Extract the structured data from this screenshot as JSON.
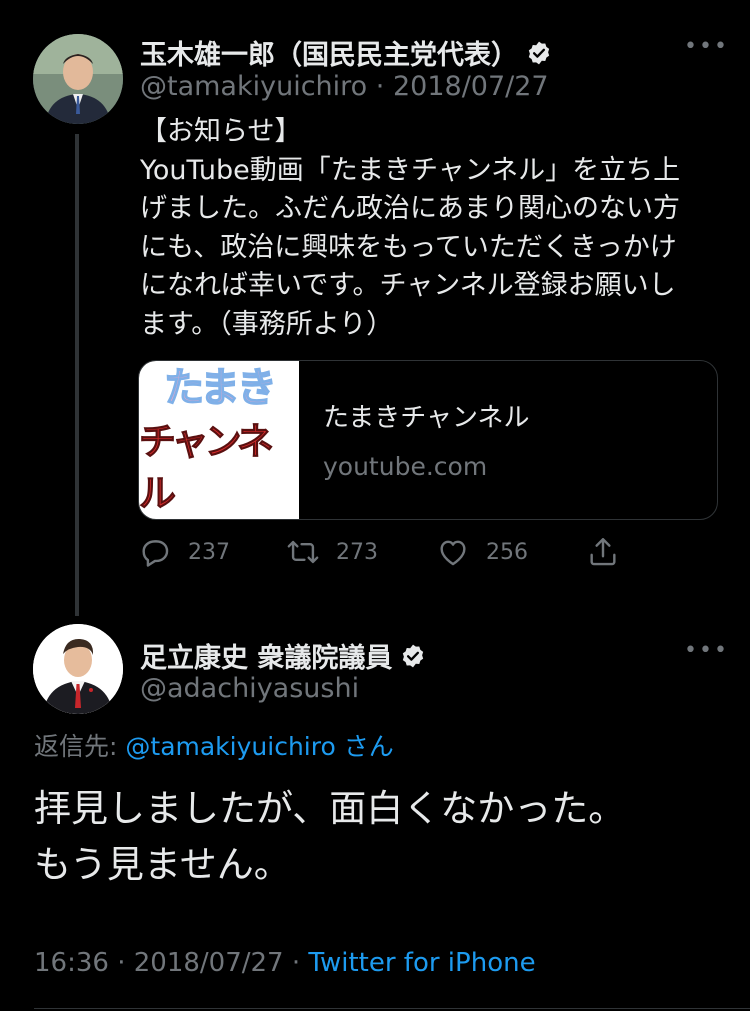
{
  "tweet1": {
    "author_name": "玉木雄一郎（国民民主党代表）",
    "handle": "@tamakiyuichiro",
    "separator": "·",
    "date": "2018/07/27",
    "text_lines": [
      "【お知らせ】",
      "YouTube動画「たまきチャンネル」を立ち上",
      "げました。ふだん政治にあまり関心のない方",
      "にも、政治に興味をもっていただくきっかけ",
      "になれば幸いです。チャンネル登録お願いし",
      "ます。（事務所より）"
    ],
    "card": {
      "thumb_line1": "たまき",
      "thumb_line2": "チャンネル",
      "title": "たまきチャンネル",
      "domain": "youtube.com"
    },
    "actions": {
      "replies": "237",
      "retweets": "273",
      "likes": "256"
    }
  },
  "tweet2": {
    "author_name": "足立康史 衆議院議員",
    "handle": "@adachiyasushi",
    "reply_label": "返信先:",
    "reply_mention": "@tamakiyuichiro",
    "reply_suffix": "さん",
    "text_lines": [
      "拝見しましたが、面白くなかった。",
      "もう見ません。"
    ],
    "time": "16:36",
    "separator": "·",
    "date": "2018/07/27",
    "separator2": "·",
    "source": "Twitter for iPhone"
  },
  "icons": {
    "more": "more-dots-icon",
    "verified": "verified-badge-icon",
    "reply": "reply-icon",
    "retweet": "retweet-icon",
    "like": "heart-icon",
    "share": "share-icon"
  },
  "colors": {
    "background": "#000000",
    "text": "#e7e9ea",
    "muted": "#71767b",
    "link": "#1d9bf0",
    "border": "#2f3336"
  }
}
